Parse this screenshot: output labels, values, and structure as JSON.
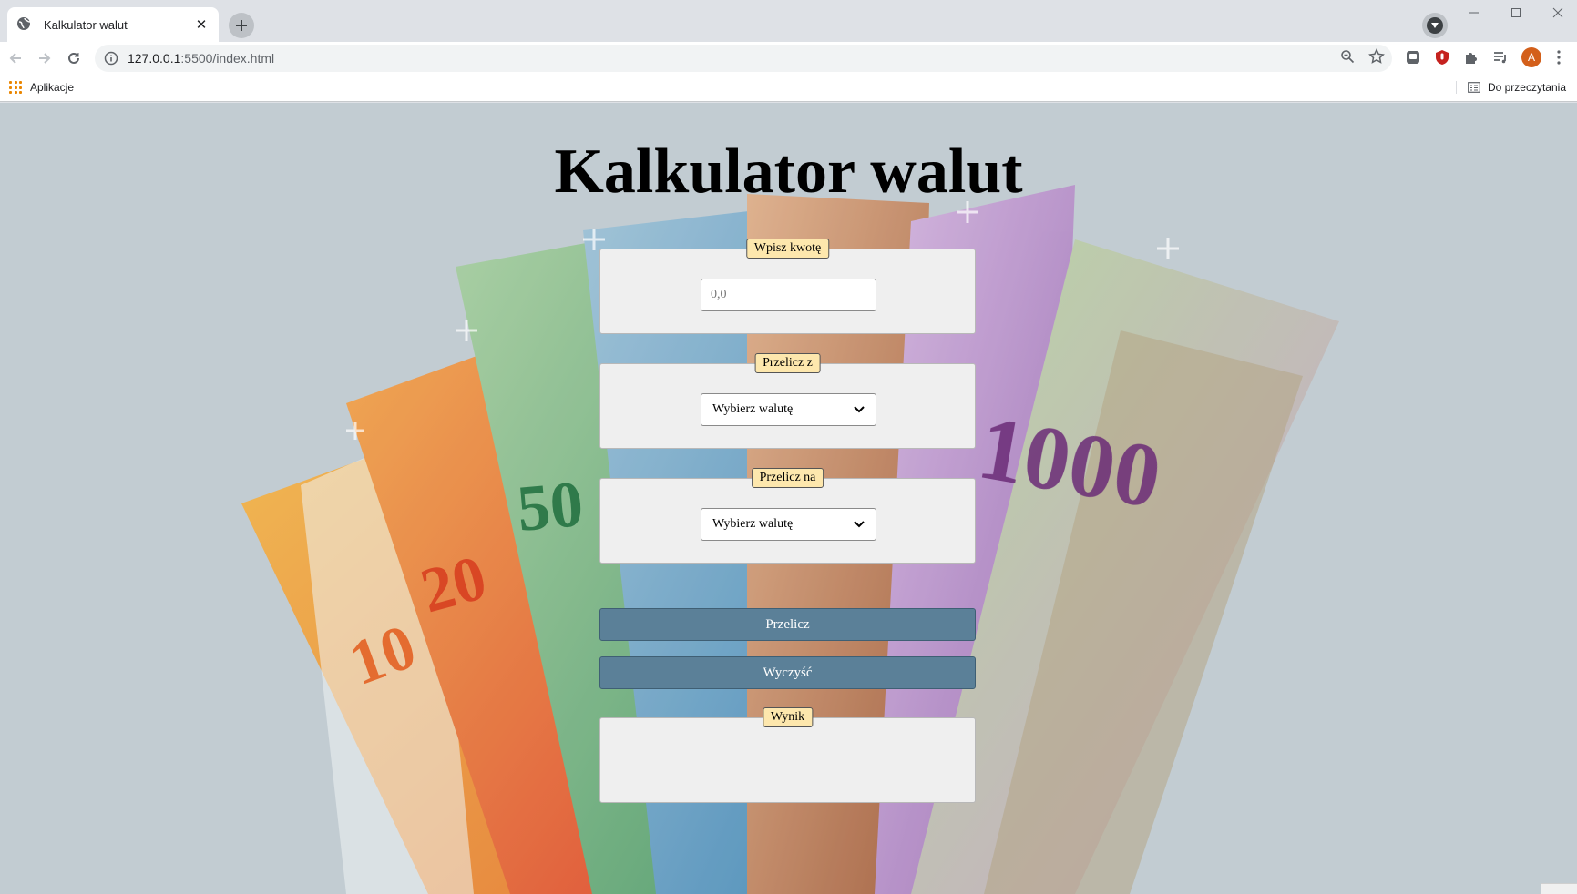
{
  "browser": {
    "tab_title": "Kalkulator walut",
    "url_host": "127.0.0.1",
    "url_rest": ":5500/index.html",
    "bookmark_apps": "Aplikacje",
    "bookmark_reading_list": "Do przeczytania",
    "avatar_letter": "A",
    "icons": [
      "globe-icon",
      "close-icon",
      "plus-icon",
      "media-control-icon",
      "minimize-icon",
      "maximize-icon",
      "window-close-icon",
      "back-arrow-icon",
      "forward-arrow-icon",
      "reload-icon",
      "info-icon",
      "zoom-icon",
      "star-icon",
      "extension-icon",
      "extensions-puzzle-icon",
      "queue-icon",
      "menu-dots-icon",
      "apps-grid-icon",
      "reading-list-icon"
    ]
  },
  "page": {
    "title": "Kalkulator walut",
    "amount": {
      "legend": "Wpisz kwotę",
      "placeholder": "0,0",
      "value": ""
    },
    "from": {
      "legend": "Przelicz z",
      "selected": "Wybierz walutę"
    },
    "to": {
      "legend": "Przelicz na",
      "selected": "Wybierz walutę"
    },
    "convert_button": "Przelicz",
    "clear_button": "Wyczyść",
    "result": {
      "legend": "Wynik",
      "value": ""
    }
  },
  "colors": {
    "page_background": "#c2ccd2",
    "legend_background": "#fde7ad",
    "button_background": "#5b8098",
    "panel_background": "#efefef"
  }
}
